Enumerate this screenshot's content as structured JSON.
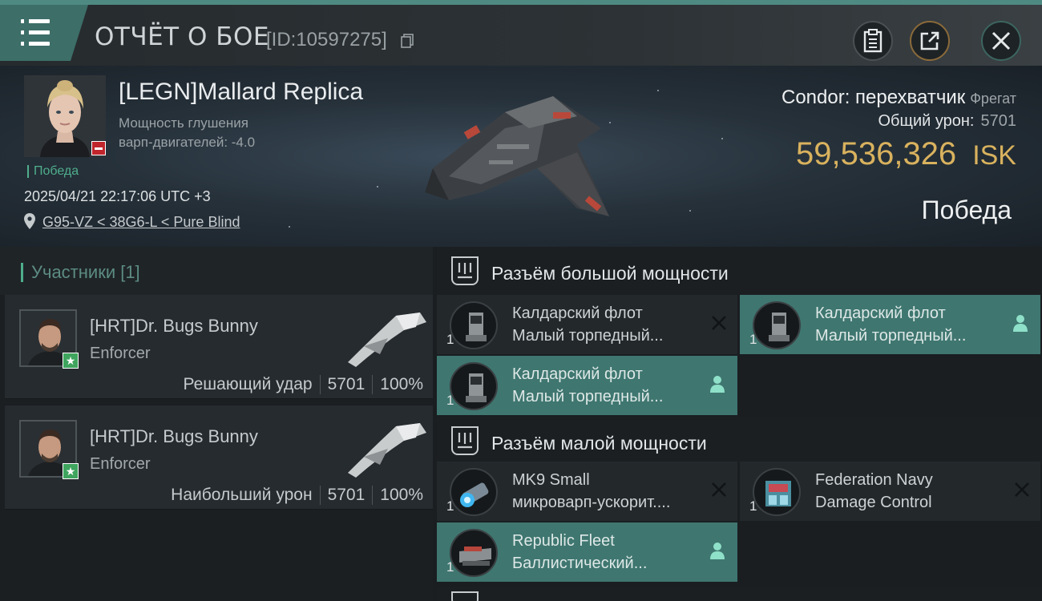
{
  "header": {
    "title": "ОТЧЁТ О БОЕ",
    "report_id": "[ID:10597275]"
  },
  "victim": {
    "name": "[LEGN]Mallard Replica",
    "note_line1": "Мощность глушения",
    "note_line2": "варп-двигателей: -4.0",
    "result_tag": "Победа",
    "datetime": "2025/04/21 22:17:06 UTC +3",
    "location": "G95-VZ < 38G6-L < Pure Blind",
    "ship_name": "Condor: перехватчик",
    "ship_class": "Фрегат",
    "damage_label": "Общий урон:",
    "damage_value": "5701",
    "isk_value": "59,536,326",
    "isk_unit": "ISK",
    "result_big": "Победа"
  },
  "participants": {
    "title": "Участники [1]",
    "items": [
      {
        "name": "[HRT]Dr. Bugs Bunny",
        "ship": "Enforcer",
        "role": "Решающий удар",
        "damage": "5701",
        "percent": "100%"
      },
      {
        "name": "[HRT]Dr. Bugs Bunny",
        "ship": "Enforcer",
        "role": "Наибольший урон",
        "damage": "5701",
        "percent": "100%"
      }
    ]
  },
  "fitting": {
    "high_title": "Разъём большой мощности",
    "high": [
      {
        "qty": "1",
        "line1": "Калдарский флот",
        "line2": "Малый торпедный...",
        "state": "destroyed",
        "icon": "torpedo-launcher-icon"
      },
      {
        "qty": "1",
        "line1": "Калдарский флот",
        "line2": "Малый торпедный...",
        "state": "dropped",
        "icon": "torpedo-launcher-icon"
      },
      {
        "qty": "1",
        "line1": "Калдарский флот",
        "line2": "Малый торпедный...",
        "state": "dropped",
        "icon": "torpedo-launcher-icon"
      }
    ],
    "low_title": "Разъём малой мощности",
    "low": [
      {
        "qty": "1",
        "line1": "MK9 Small",
        "line2": "микроварп-ускорит....",
        "state": "destroyed",
        "icon": "microwarpdrive-icon"
      },
      {
        "qty": "1",
        "line1": "Federation Navy",
        "line2": "Damage Control",
        "state": "destroyed",
        "icon": "damage-control-icon"
      },
      {
        "qty": "1",
        "line1": "Republic Fleet",
        "line2": "Баллистический...",
        "state": "dropped",
        "icon": "ballistic-control-icon"
      }
    ]
  },
  "colors": {
    "accent_teal": "#3f7670",
    "isk_gold": "#d9b25e",
    "victory_green": "#4fae8c",
    "loss_red": "#c0252c"
  }
}
